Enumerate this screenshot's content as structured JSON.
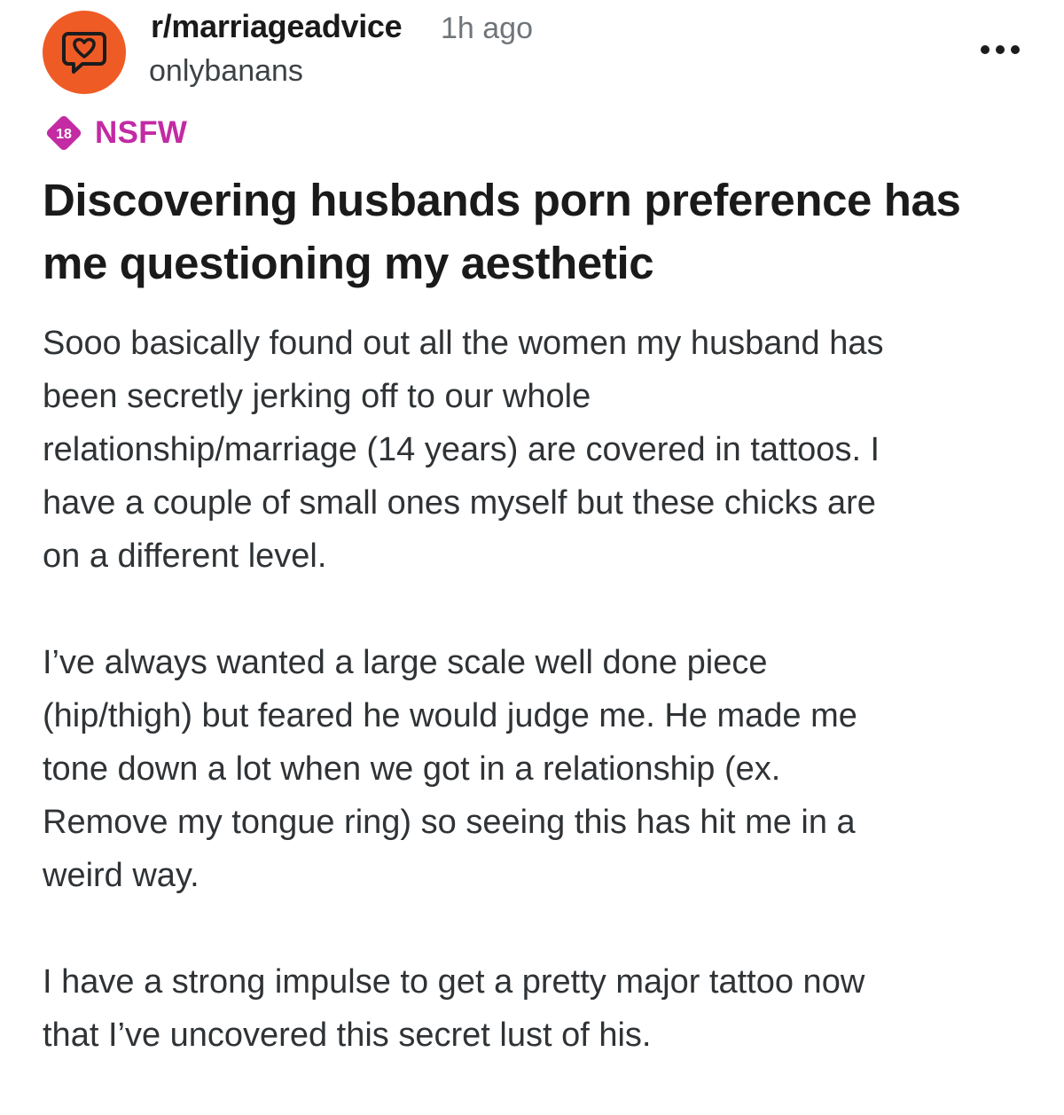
{
  "header": {
    "subreddit": "r/marriageadvice",
    "time": "1h ago",
    "username": "onlybanans"
  },
  "badge": {
    "age_label": "18",
    "label": "NSFW"
  },
  "post": {
    "title": "Discovering husbands porn preference has me questioning my aesthetic",
    "paragraphs": [
      "Sooo basically found out all the women my husband has\nbeen secretly jerking off to our whole\nrelationship/marriage (14 years) are covered in tattoos. I\nhave a couple of small ones myself but these chicks are\non a different level.",
      "I’ve always wanted a large scale well done piece\n(hip/thigh) but feared he would judge me. He made me\ntone down a lot when we got in a relationship (ex.\nRemove my tongue ring) so seeing this has hit me in a\nweird way.",
      "I have a strong impulse to get a pretty major tattoo now\nthat I’ve uncovered this secret lust of his."
    ]
  },
  "icons": {
    "avatar": "chat-heart-icon",
    "more": "more-horizontal-icon",
    "nsfw": "nsfw-18-icon"
  },
  "colors": {
    "avatar_bg": "#ef5b25",
    "nsfw": "#c32aa3",
    "meta": "#6f757a"
  }
}
